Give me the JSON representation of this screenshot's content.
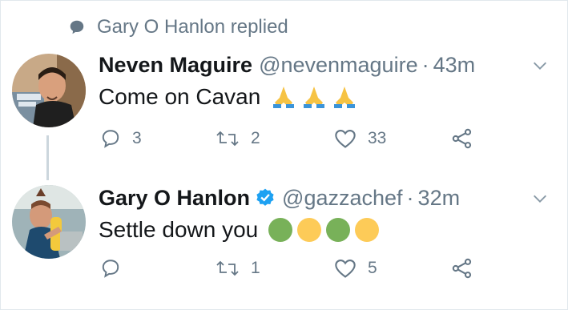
{
  "context": {
    "text": "Gary O Hanlon replied",
    "icon": "speech-bubble-icon"
  },
  "colors": {
    "secondary_text": "#657786",
    "verified_blue": "#1da1f2",
    "thread_line": "#ccd6dd"
  },
  "tweets": [
    {
      "name": "Neven Maguire",
      "handle": "@nevenmaguire",
      "separator": "·",
      "time": "43m",
      "text": "Come on Cavan",
      "verified": false,
      "emojis": [
        "folded-hands-emoji",
        "folded-hands-emoji",
        "folded-hands-emoji"
      ],
      "replies": "3",
      "retweets": "2",
      "likes": "33"
    },
    {
      "name": "Gary O Hanlon",
      "handle": "@gazzachef",
      "separator": "·",
      "time": "32m",
      "text": "Settle down you",
      "verified": true,
      "emojis": [
        "green-circle-emoji",
        "yellow-circle-emoji",
        "green-circle-emoji",
        "yellow-circle-emoji"
      ],
      "replies": "",
      "retweets": "1",
      "likes": "5"
    }
  ]
}
